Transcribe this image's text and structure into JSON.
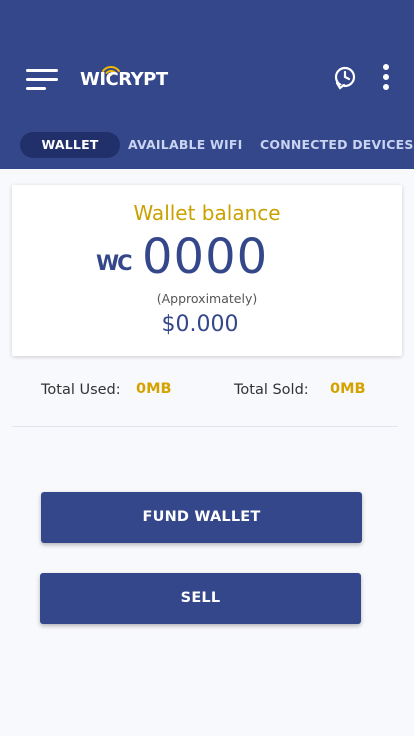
{
  "header": {
    "logo_text": "WICRYPT",
    "icons": {
      "menu": "hamburger-menu-icon",
      "history": "clock-history-icon",
      "more": "vertical-dots-icon",
      "logo_wifi": "wifi-signal-icon"
    },
    "colors": {
      "primary": "#34478a",
      "active_tab": "#21306a",
      "accent": "#c9a100"
    }
  },
  "tabs": [
    {
      "label": "WALLET",
      "active": true
    },
    {
      "label": "AVAILABLE  WIFI",
      "active": false
    },
    {
      "label": "CONNECTED DEVICES",
      "active": false
    }
  ],
  "wallet": {
    "title": "Wallet balance",
    "currency_label": "WC",
    "balance": "0000",
    "approx_label": "(Approximately)",
    "usd_value": "$0.000"
  },
  "stats": {
    "used_label": "Total Used:",
    "used_value": "0MB",
    "sold_label": "Total Sold:",
    "sold_value": "0MB"
  },
  "actions": {
    "fund_label": "FUND WALLET",
    "sell_label": "SELL"
  }
}
